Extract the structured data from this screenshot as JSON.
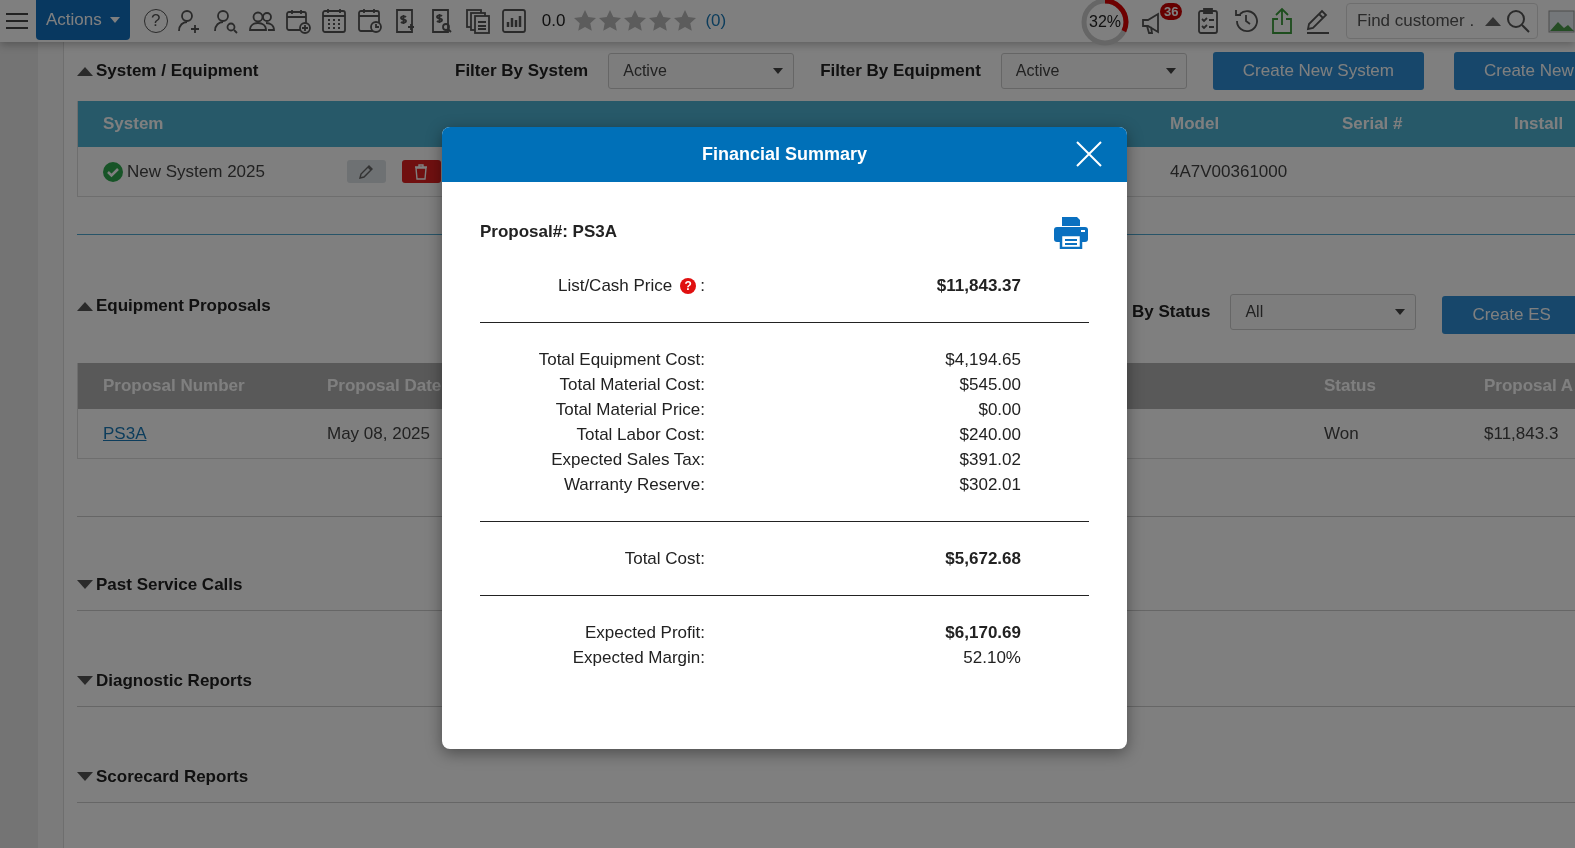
{
  "toolbar": {
    "actions_button": "Actions",
    "help_icon": "?",
    "rating": "0.0",
    "stars": 0,
    "review_count": "(0)",
    "progress": {
      "level": 0.32,
      "reading": "32%"
    },
    "notification_count": "36",
    "search": {
      "placeholder": "Find customer ."
    }
  },
  "sections": [
    {
      "title": "System / Equipment",
      "expanded": true,
      "kind": "systems",
      "filters": [
        {
          "label": "Filter By System",
          "value": "Active"
        },
        {
          "label": "Filter By Equipment",
          "value": "Active"
        }
      ],
      "buttons": [
        "Create New System",
        "Create New"
      ],
      "columns": [
        "System",
        "Model",
        "Serial #",
        "Install"
      ],
      "rows": [
        {
          "name": "New System 2025",
          "active": true,
          "model": "4A7V00361000"
        }
      ]
    },
    {
      "title": "Equipment Proposals",
      "expanded": true,
      "kind": "proposals",
      "filters": [
        {
          "label": "By Status",
          "value": "All"
        }
      ],
      "buttons": [
        "Create ES"
      ],
      "columns": [
        "Proposal Number",
        "Proposal Date",
        "Status",
        "Proposal A"
      ],
      "rows": [
        {
          "number": "PS3A",
          "date": "May 08, 2025",
          "status": "Won",
          "amount": "$11,843.3"
        }
      ]
    },
    {
      "title": "Past Service Calls",
      "expanded": false,
      "kind": "plain"
    },
    {
      "title": "Diagnostic Reports",
      "expanded": false,
      "kind": "plain"
    },
    {
      "title": "Scorecard Reports",
      "expanded": false,
      "kind": "plain"
    }
  ],
  "modal": {
    "title": "Financial Summary",
    "proposal": "Proposal#: PS3A",
    "groups": [
      {
        "rows": [
          {
            "label": "List/Cash Price",
            "help": "?",
            "suffix": ":",
            "value": "$11,843.37",
            "bold": true
          }
        ]
      },
      {
        "rows": [
          {
            "label": "Total Equipment Cost:",
            "value": "$4,194.65",
            "bold": false
          },
          {
            "label": "Total Material Cost:",
            "value": "$545.00",
            "bold": false
          },
          {
            "label": "Total Material Price:",
            "value": "$0.00",
            "bold": false
          },
          {
            "label": "Total Labor Cost:",
            "value": "$240.00",
            "bold": false
          },
          {
            "label": "Expected Sales Tax:",
            "value": "$391.02",
            "bold": false
          },
          {
            "label": "Warranty Reserve:",
            "value": "$302.01",
            "bold": false
          }
        ]
      },
      {
        "rows": [
          {
            "label": "Total Cost:",
            "value": "$5,672.68",
            "bold": true
          }
        ]
      },
      {
        "rows": [
          {
            "label": "Expected Profit:",
            "value": "$6,170.69",
            "bold": true
          },
          {
            "label": "Expected Margin:",
            "value": "52.10%",
            "bold": false
          }
        ]
      }
    ]
  }
}
